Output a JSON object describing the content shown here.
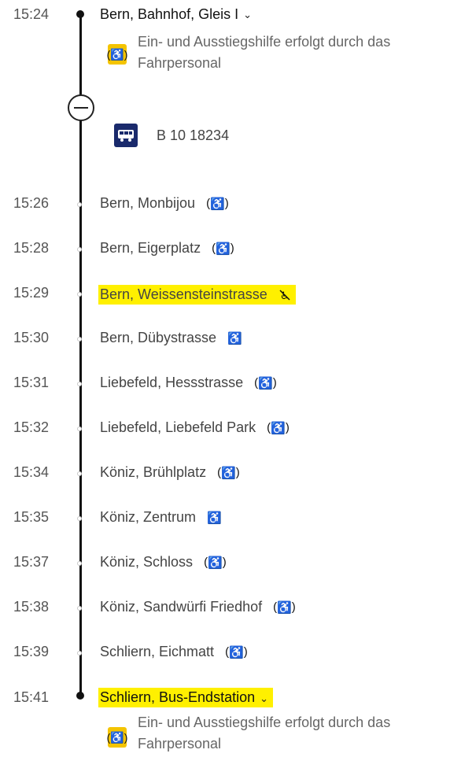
{
  "colors": {
    "line": "#111111",
    "highlight": "#fff000",
    "badge": "#f4c400",
    "bus_icon_bg": "#1a2a6c"
  },
  "origin": {
    "time": "15:24",
    "stop": "Bern, Bahnhof, Gleis I",
    "note": "Ein- und Ausstiegshilfe erfolgt durch das Fahrpersonal"
  },
  "vehicle": {
    "icon": "bus-icon",
    "label": "B 10 18234"
  },
  "stops": [
    {
      "time": "15:26",
      "name": "Bern, Monbijou",
      "access": "paren"
    },
    {
      "time": "15:28",
      "name": "Bern, Eigerplatz",
      "access": "paren"
    },
    {
      "time": "15:29",
      "name": "Bern, Weissensteinstrasse",
      "access": "none",
      "highlight": true
    },
    {
      "time": "15:30",
      "name": "Bern, Dübystrasse",
      "access": "full"
    },
    {
      "time": "15:31",
      "name": "Liebefeld, Hessstrasse",
      "access": "paren"
    },
    {
      "time": "15:32",
      "name": "Liebefeld, Liebefeld Park",
      "access": "paren"
    },
    {
      "time": "15:34",
      "name": "Köniz, Brühlplatz",
      "access": "paren"
    },
    {
      "time": "15:35",
      "name": "Köniz, Zentrum",
      "access": "full"
    },
    {
      "time": "15:37",
      "name": "Köniz, Schloss",
      "access": "paren"
    },
    {
      "time": "15:38",
      "name": "Köniz, Sandwürfi Friedhof",
      "access": "paren"
    },
    {
      "time": "15:39",
      "name": "Schliern, Eichmatt",
      "access": "paren"
    }
  ],
  "destination": {
    "time": "15:41",
    "stop": "Schliern, Bus-Endstation",
    "note": "Ein- und Ausstiegshilfe erfolgt durch das Fahrpersonal"
  }
}
